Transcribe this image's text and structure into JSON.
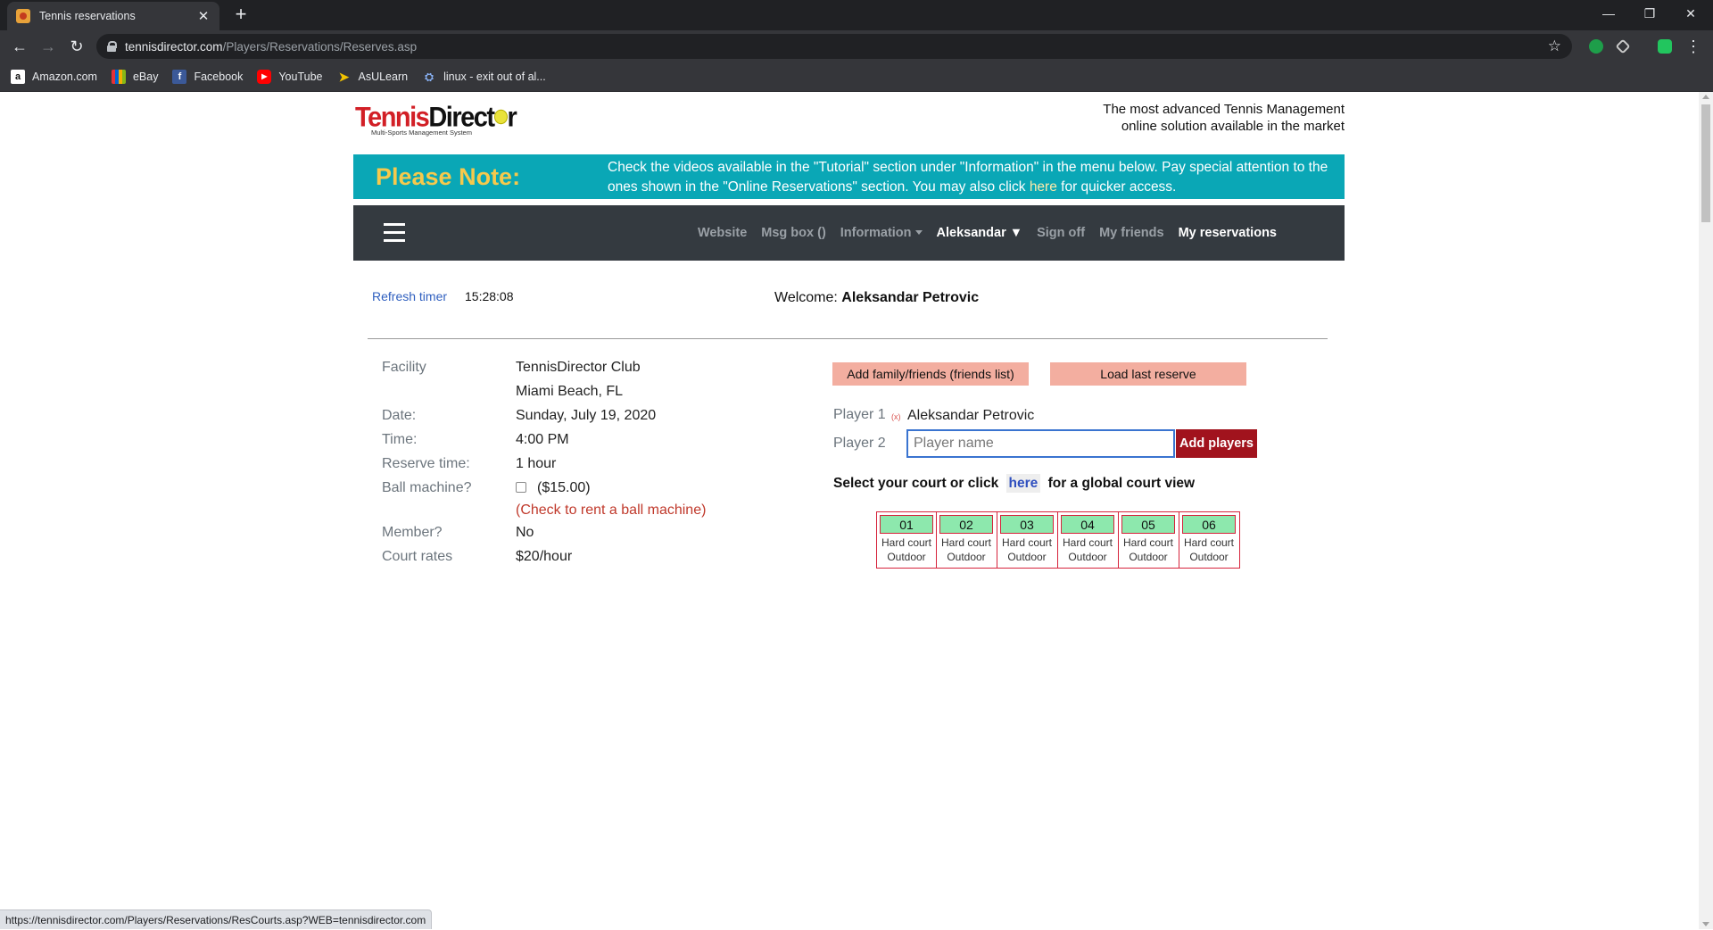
{
  "browser": {
    "tab_title": "Tennis reservations",
    "url_host": "tennisdirector.com",
    "url_path": "/Players/Reservations/Reserves.asp",
    "bookmarks": [
      {
        "label": "Amazon.com",
        "icon": "amazon-icon",
        "color": "#ffffff"
      },
      {
        "label": "eBay",
        "icon": "ebay-icon",
        "color": "#e53238"
      },
      {
        "label": "Facebook",
        "icon": "facebook-icon",
        "color": "#3b5998"
      },
      {
        "label": "YouTube",
        "icon": "youtube-icon",
        "color": "#ff0000"
      },
      {
        "label": "AsULearn",
        "icon": "asulearn-icon",
        "color": "#f2c300"
      },
      {
        "label": "linux - exit out of al...",
        "icon": "linux-icon",
        "color": "#8ab4f8"
      }
    ],
    "status_url": "https://tennisdirector.com/Players/Reservations/ResCourts.asp?WEB=tennisdirector.com"
  },
  "header": {
    "logo_text_red": "Tennis",
    "logo_text_black_1": "Direct",
    "logo_text_black_2": "r",
    "logo_sub": "Multi-Sports Management System",
    "tagline_1": "The most advanced Tennis Management",
    "tagline_2": "online solution available in the market"
  },
  "note": {
    "title": "Please Note:",
    "text_before": "Check the videos available in the \"Tutorial\" section under \"Information\" in the menu below. Pay special attention to the ones shown in the \"Online Reservations\" section. You may also click ",
    "link": "here",
    "text_after": " for quicker access."
  },
  "menu": {
    "items": [
      {
        "label": "Website",
        "active": false
      },
      {
        "label": "Msg box ()",
        "active": false
      },
      {
        "label": "Information",
        "active": false
      },
      {
        "label": "Aleksandar ▼",
        "active": true
      },
      {
        "label": "Sign off",
        "active": false
      },
      {
        "label": "My friends",
        "active": false
      },
      {
        "label": "My reservations",
        "active": true
      }
    ]
  },
  "session": {
    "refresh_label": "Refresh timer",
    "timer": "15:28:08",
    "welcome_label": "Welcome:",
    "user_name": "Aleksandar Petrovic"
  },
  "reservation": {
    "facility_label": "Facility",
    "facility_name": "TennisDirector Club",
    "facility_location": "Miami Beach, FL",
    "date_label": "Date:",
    "date": "Sunday, July 19, 2020",
    "time_label": "Time:",
    "time": "4:00 PM",
    "reserve_time_label": "Reserve time:",
    "reserve_time": "1 hour",
    "ball_machine_label": "Ball machine?",
    "ball_machine_price": "($15.00)",
    "ball_machine_note": "(Check to rent a ball machine)",
    "member_label": "Member?",
    "member": "No",
    "court_rates_label": "Court rates",
    "court_rates": "$20/hour"
  },
  "players": {
    "add_friends_button": "Add family/friends (friends list)",
    "load_last_button": "Load last reserve",
    "player1_label": "Player 1",
    "player1_remove": "(x)",
    "player1_name": "Aleksandar Petrovic",
    "player2_label": "Player 2",
    "player2_placeholder": "Player name",
    "add_players_button": "Add players"
  },
  "courts": {
    "prompt_before": "Select your court or click",
    "prompt_link": "here",
    "prompt_after": "for a global court view",
    "list": [
      {
        "number": "01",
        "surface": "Hard court",
        "location": "Outdoor"
      },
      {
        "number": "02",
        "surface": "Hard court",
        "location": "Outdoor"
      },
      {
        "number": "03",
        "surface": "Hard court",
        "location": "Outdoor"
      },
      {
        "number": "04",
        "surface": "Hard court",
        "location": "Outdoor"
      },
      {
        "number": "05",
        "surface": "Hard court",
        "location": "Outdoor"
      },
      {
        "number": "06",
        "surface": "Hard court",
        "location": "Outdoor"
      }
    ]
  }
}
